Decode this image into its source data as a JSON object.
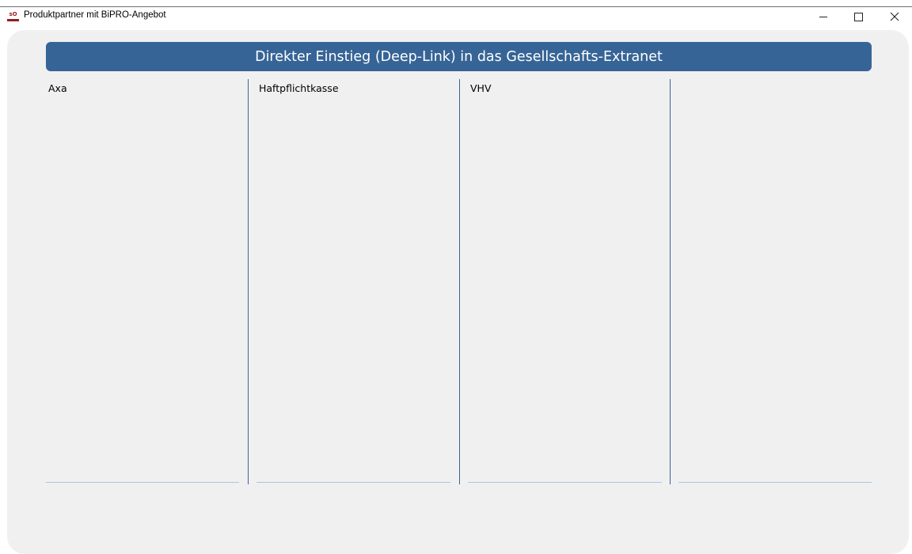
{
  "window": {
    "title": "Produktpartner mit BiPRO-Angebot",
    "icon_text": "sO",
    "controls": {
      "minimize": "–",
      "maximize": "☐",
      "close": "✕"
    }
  },
  "banner": {
    "label": "Direkter Einstieg (Deep-Link) in das Gesellschafts-Extranet"
  },
  "columns": [
    {
      "header": "Axa"
    },
    {
      "header": "Haftpflichtkasse"
    },
    {
      "header": "VHV"
    },
    {
      "header": ""
    }
  ],
  "colors": {
    "banner_bg": "#366496",
    "divider": "#3b6496",
    "background": "#f0f0f0"
  }
}
